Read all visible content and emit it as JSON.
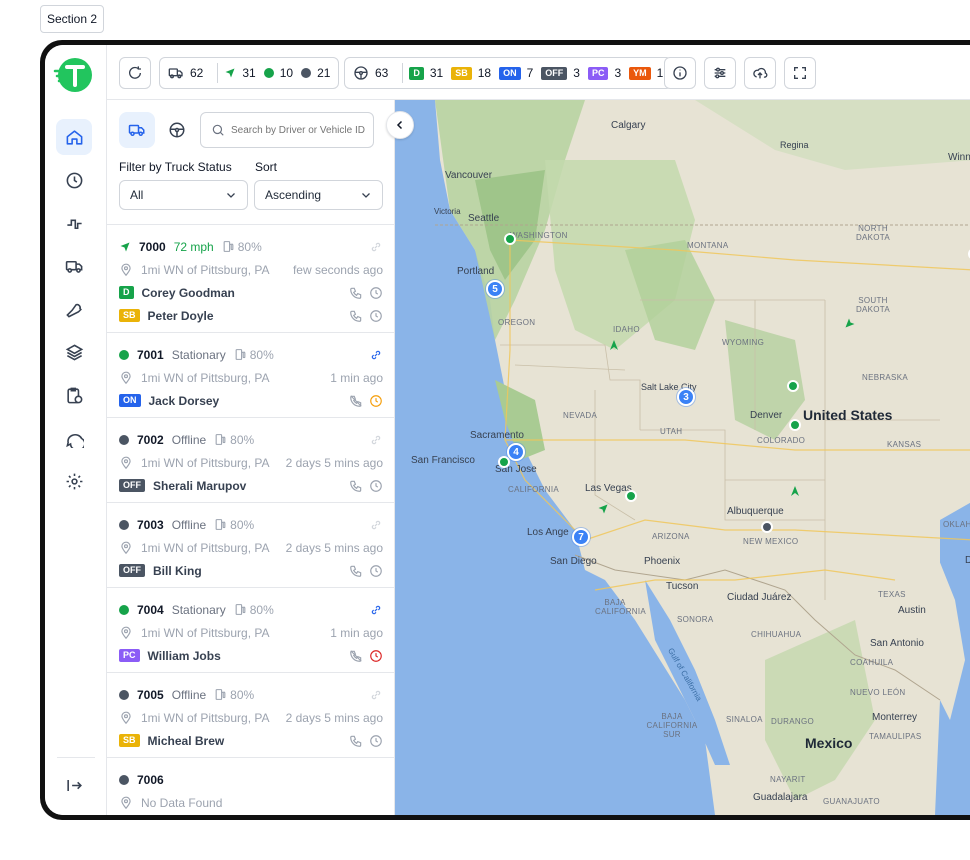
{
  "section_label": "Section 2",
  "topbar": {
    "trucks": {
      "total": "62",
      "moving": "31",
      "stationary": "10",
      "offline": "21"
    },
    "drivers": {
      "total": "63"
    },
    "duty": [
      {
        "code": "D",
        "count": "31"
      },
      {
        "code": "SB",
        "count": "18"
      },
      {
        "code": "ON",
        "count": "7"
      },
      {
        "code": "OFF",
        "count": "3"
      },
      {
        "code": "PC",
        "count": "3"
      },
      {
        "code": "YM",
        "count": "1"
      }
    ]
  },
  "panel": {
    "search_placeholder": "Search by Driver or Vehicle ID",
    "filter_label": "Filter by Truck Status",
    "filter_value": "All",
    "sort_label": "Sort",
    "sort_value": "Ascending"
  },
  "vehicles": [
    {
      "id": "7000",
      "status": "72 mph",
      "fuel": "80%",
      "location": "1mi WN of Pittsburg, PA",
      "time": "few seconds ago",
      "drivers": [
        {
          "code": "D",
          "name": "Corey Goodman"
        },
        {
          "code": "SB",
          "name": "Peter Doyle"
        }
      ]
    },
    {
      "id": "7001",
      "status": "Stationary",
      "fuel": "80%",
      "location": "1mi WN of Pittsburg, PA",
      "time": "1 min ago",
      "drivers": [
        {
          "code": "ON",
          "name": "Jack Dorsey"
        }
      ]
    },
    {
      "id": "7002",
      "status": "Offline",
      "fuel": "80%",
      "location": "1mi WN of Pittsburg, PA",
      "time": "2 days 5 mins ago",
      "drivers": [
        {
          "code": "OFF",
          "name": "Sherali Marupov"
        }
      ]
    },
    {
      "id": "7003",
      "status": "Offline",
      "fuel": "80%",
      "location": "1mi WN of Pittsburg, PA",
      "time": "2 days 5 mins ago",
      "drivers": [
        {
          "code": "OFF",
          "name": "Bill King"
        }
      ]
    },
    {
      "id": "7004",
      "status": "Stationary",
      "fuel": "80%",
      "location": "1mi WN of Pittsburg, PA",
      "time": "1 min ago",
      "drivers": [
        {
          "code": "PC",
          "name": "William Jobs"
        }
      ]
    },
    {
      "id": "7005",
      "status": "Offline",
      "fuel": "80%",
      "location": "1mi WN of Pittsburg, PA",
      "time": "2 days 5 mins ago",
      "drivers": [
        {
          "code": "SB",
          "name": "Micheal Brew"
        }
      ]
    },
    {
      "id": "7006",
      "location_nodata": "No Data Found"
    }
  ],
  "map": {
    "labels": {
      "calgary": "Calgary",
      "regina": "Regina",
      "winnipeg": "Winni",
      "vancouver": "Vancouver",
      "victoria": "Victoria",
      "seattle": "Seattle",
      "washington": "WASHINGTON",
      "montana": "MONTANA",
      "north_dakota": "NORTH DAKOTA",
      "portland": "Portland",
      "oregon": "OREGON",
      "idaho": "IDAHO",
      "south_dakota": "SOUTH DAKOTA",
      "wyoming": "WYOMING",
      "nebraska": "NEBRASKA",
      "salt_lake": "Salt Lake City",
      "nevada": "NEVADA",
      "utah": "UTAH",
      "denver": "Denver",
      "united_states": "United States",
      "colorado": "COLORADO",
      "kansas": "KANSAS",
      "sacramento": "Sacramento",
      "san_francisco": "San Francisco",
      "san_jose": "San Jose",
      "california": "CALIFORNIA",
      "las_vegas": "Las Vegas",
      "albuquerque": "Albuquerque",
      "oklahoma": "OKLAHO",
      "los_angeles": "Los Ange",
      "arizona": "ARIZONA",
      "new_mexico": "NEW MEXICO",
      "san_diego": "San Diego",
      "phoenix": "Phoenix",
      "tucson": "Tucson",
      "ciudad_juarez": "Ciudad Juárez",
      "texas": "TEXAS",
      "austin": "Austin",
      "baja_california": "BAJA CALIFORNIA",
      "sonora": "SONORA",
      "chihuahua": "CHIHUAHUA",
      "san_antonio": "San Antonio",
      "coahuila": "COAHUILA",
      "gulf": "Gulf of California",
      "nuevo_leon": "NUEVO LEÓN",
      "baja_sur": "BAJA CALIFORNIA SUR",
      "sinaloa": "SINALOA",
      "durango": "DURANGO",
      "monterrey": "Monterrey",
      "tamaulipas": "TAMAULIPAS",
      "mexico": "Mexico",
      "nayarit": "NAYARIT",
      "guadalajara": "Guadalajara",
      "guanajuato": "GUANAJUATO",
      "dallas": "Da"
    },
    "clusters": [
      "5",
      "3",
      "4",
      "7"
    ]
  },
  "colors": {
    "accent": "#2563eb",
    "moving": "#16a34a",
    "offline": "#4b5563",
    "warning": "#f59e0b",
    "danger": "#dc2626"
  }
}
